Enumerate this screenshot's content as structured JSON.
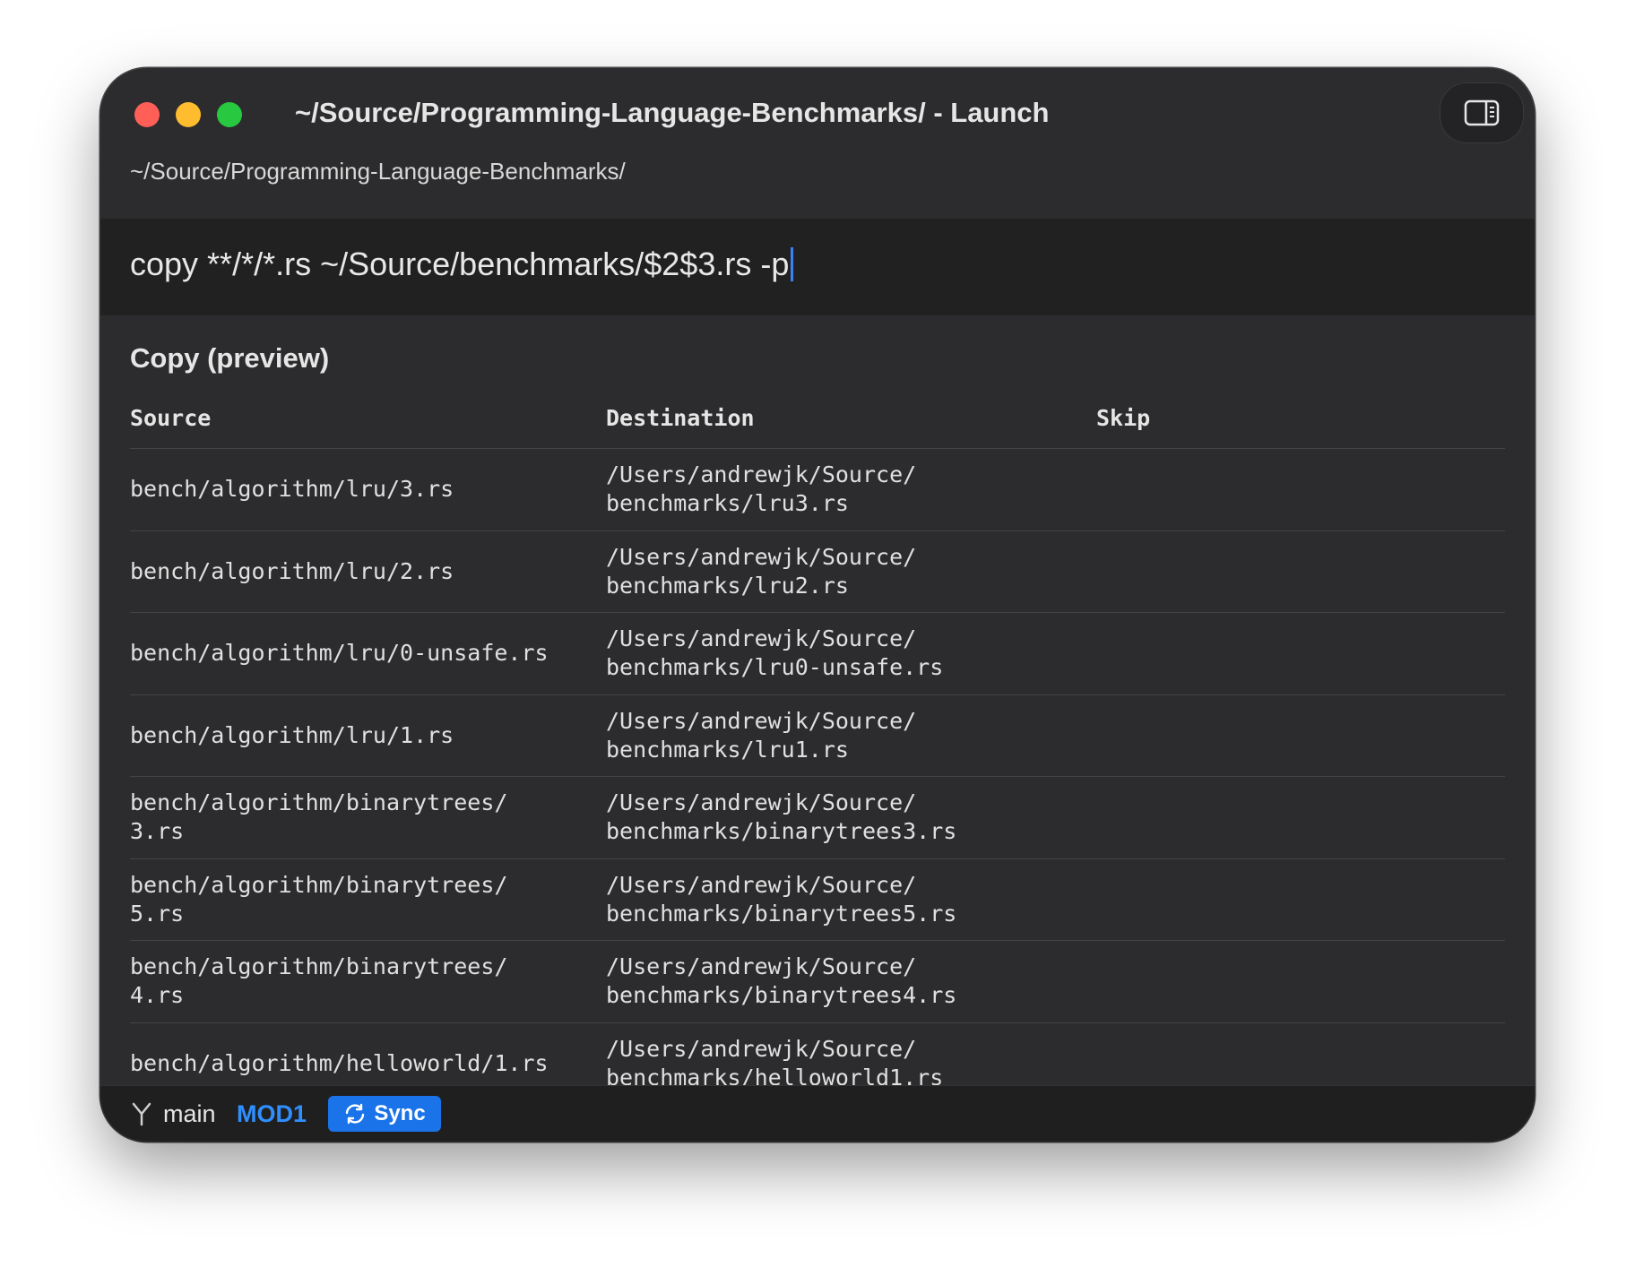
{
  "window": {
    "title": "~/Source/Programming-Language-Benchmarks/ - Launch"
  },
  "path": "~/Source/Programming-Language-Benchmarks/",
  "command": {
    "value": "copy **/*/*.rs ~/Source/benchmarks/$2$3.rs -p"
  },
  "preview": {
    "title": "Copy (preview)",
    "columns": [
      "Source",
      "Destination",
      "Skip"
    ],
    "rows": [
      {
        "source": "bench/algorithm/lru/3.rs",
        "destination": "/Users/andrewjk/Source/\nbenchmarks/lru3.rs",
        "skip": ""
      },
      {
        "source": "bench/algorithm/lru/2.rs",
        "destination": "/Users/andrewjk/Source/\nbenchmarks/lru2.rs",
        "skip": ""
      },
      {
        "source": "bench/algorithm/lru/0-unsafe.rs",
        "destination": "/Users/andrewjk/Source/\nbenchmarks/lru0-unsafe.rs",
        "skip": ""
      },
      {
        "source": "bench/algorithm/lru/1.rs",
        "destination": "/Users/andrewjk/Source/\nbenchmarks/lru1.rs",
        "skip": ""
      },
      {
        "source": "bench/algorithm/binarytrees/\n3.rs",
        "destination": "/Users/andrewjk/Source/\nbenchmarks/binarytrees3.rs",
        "skip": ""
      },
      {
        "source": "bench/algorithm/binarytrees/\n5.rs",
        "destination": "/Users/andrewjk/Source/\nbenchmarks/binarytrees5.rs",
        "skip": ""
      },
      {
        "source": "bench/algorithm/binarytrees/\n4.rs",
        "destination": "/Users/andrewjk/Source/\nbenchmarks/binarytrees4.rs",
        "skip": ""
      },
      {
        "source": "bench/algorithm/helloworld/1.rs",
        "destination": "/Users/andrewjk/Source/\nbenchmarks/helloworld1.rs",
        "skip": ""
      }
    ]
  },
  "status": {
    "branch_icon": "git-branch-icon",
    "branch": "main",
    "mod_label": "MOD1",
    "sync_label": "Sync",
    "sync_icon": "sync-icon"
  },
  "colors": {
    "window_bg": "#2c2c2e",
    "command_bg": "#212121",
    "accent": "#1a73e8",
    "mod_text": "#2f8fff"
  }
}
